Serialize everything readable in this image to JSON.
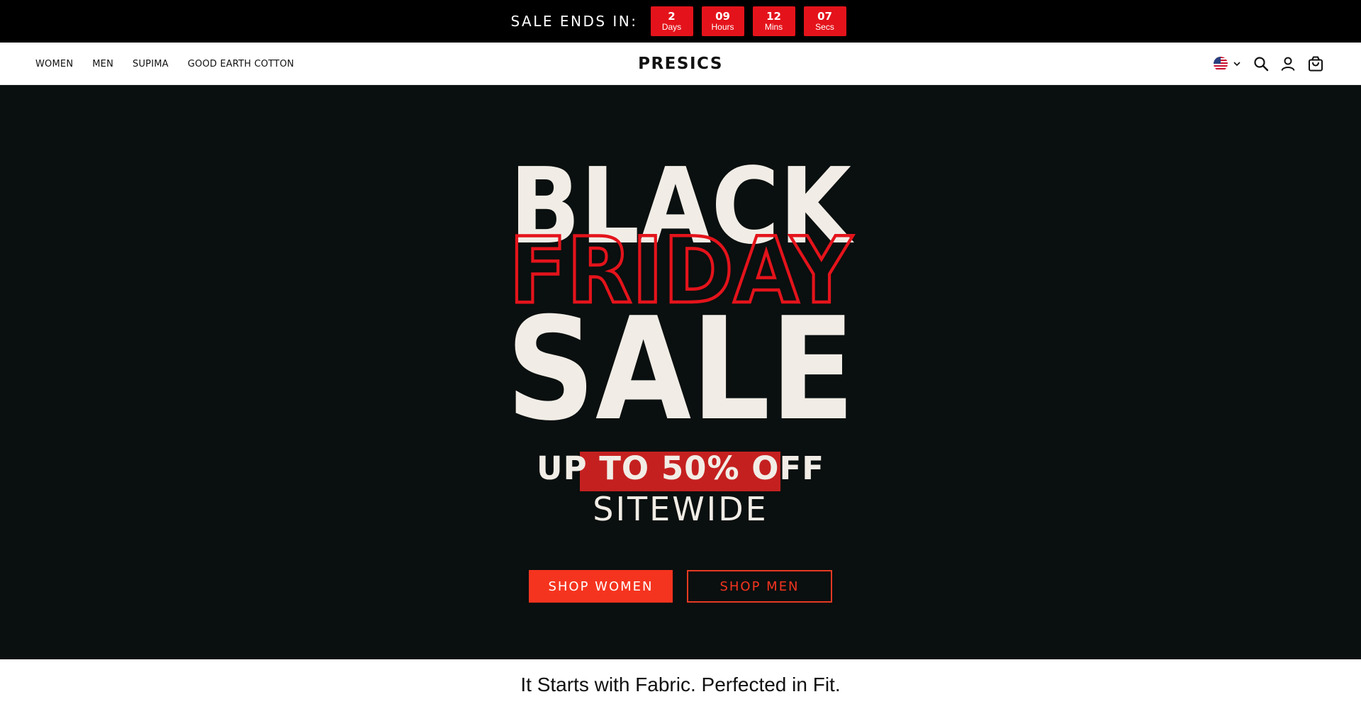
{
  "announcement": {
    "label": "SALE ENDS IN:",
    "countdown": [
      {
        "value": "2",
        "unit": "Days"
      },
      {
        "value": "09",
        "unit": "Hours"
      },
      {
        "value": "12",
        "unit": "Mins"
      },
      {
        "value": "07",
        "unit": "Secs"
      }
    ]
  },
  "nav": {
    "links": [
      "WOMEN",
      "MEN",
      "SUPIMA",
      "GOOD EARTH COTTON"
    ],
    "logo": "PRESICS",
    "icons": [
      "us-flag-icon",
      "chevron-down-icon",
      "search-icon",
      "account-icon",
      "cart-icon"
    ]
  },
  "hero": {
    "line1": "BLACK",
    "line2": "FRIDAY",
    "line3": "SALE",
    "sub1": "UP TO 50% OFF",
    "sub2": "SITEWIDE",
    "cta_women": "SHOP WOMEN",
    "cta_men": "SHOP MEN",
    "colors": {
      "background": "#0a0f0f",
      "accent": "#e4131b",
      "cream": "#f1ede6",
      "button": "#f5341f"
    }
  },
  "tagline": "It Starts with Fabric. Perfected in Fit."
}
